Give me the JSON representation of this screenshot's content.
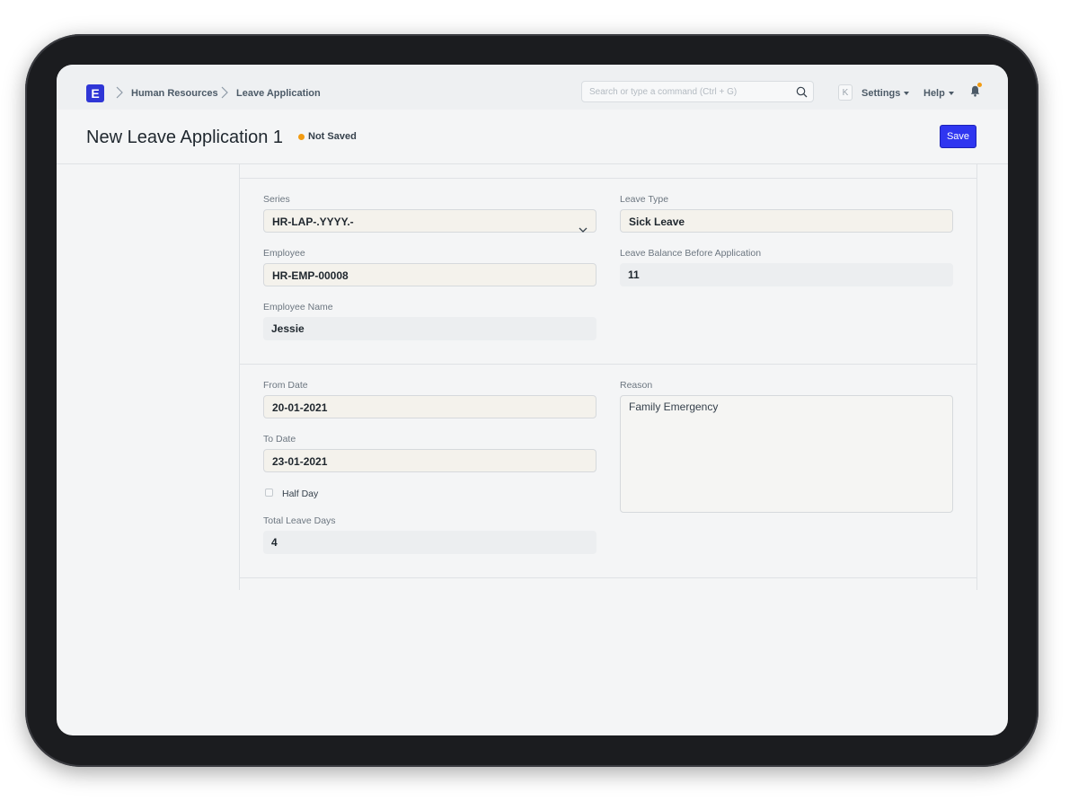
{
  "app": {
    "logo_letter": "E"
  },
  "breadcrumbs": [
    "Human Resources",
    "Leave Application"
  ],
  "search": {
    "placeholder": "Search or type a command (Ctrl + G)"
  },
  "navbar": {
    "avatar_letter": "K",
    "settings_label": "Settings",
    "help_label": "Help"
  },
  "page": {
    "title": "New Leave Application 1",
    "status": "Not Saved",
    "save_label": "Save"
  },
  "form": {
    "series": {
      "label": "Series",
      "value": "HR-LAP-.YYYY.-"
    },
    "employee": {
      "label": "Employee",
      "value": "HR-EMP-00008"
    },
    "employee_name": {
      "label": "Employee Name",
      "value": "Jessie"
    },
    "leave_type": {
      "label": "Leave Type",
      "value": "Sick Leave"
    },
    "leave_balance": {
      "label": "Leave Balance Before Application",
      "value": "11"
    },
    "from_date": {
      "label": "From Date",
      "value": "20-01-2021"
    },
    "to_date": {
      "label": "To Date",
      "value": "23-01-2021"
    },
    "half_day": {
      "label": "Half Day",
      "checked": false
    },
    "total_leave_days": {
      "label": "Total Leave Days",
      "value": "4"
    },
    "reason": {
      "label": "Reason",
      "value": "Family Emergency"
    }
  },
  "colors": {
    "primary": "#2f36f0",
    "logo": "#2f36d6",
    "indicator": "#f29b12"
  }
}
